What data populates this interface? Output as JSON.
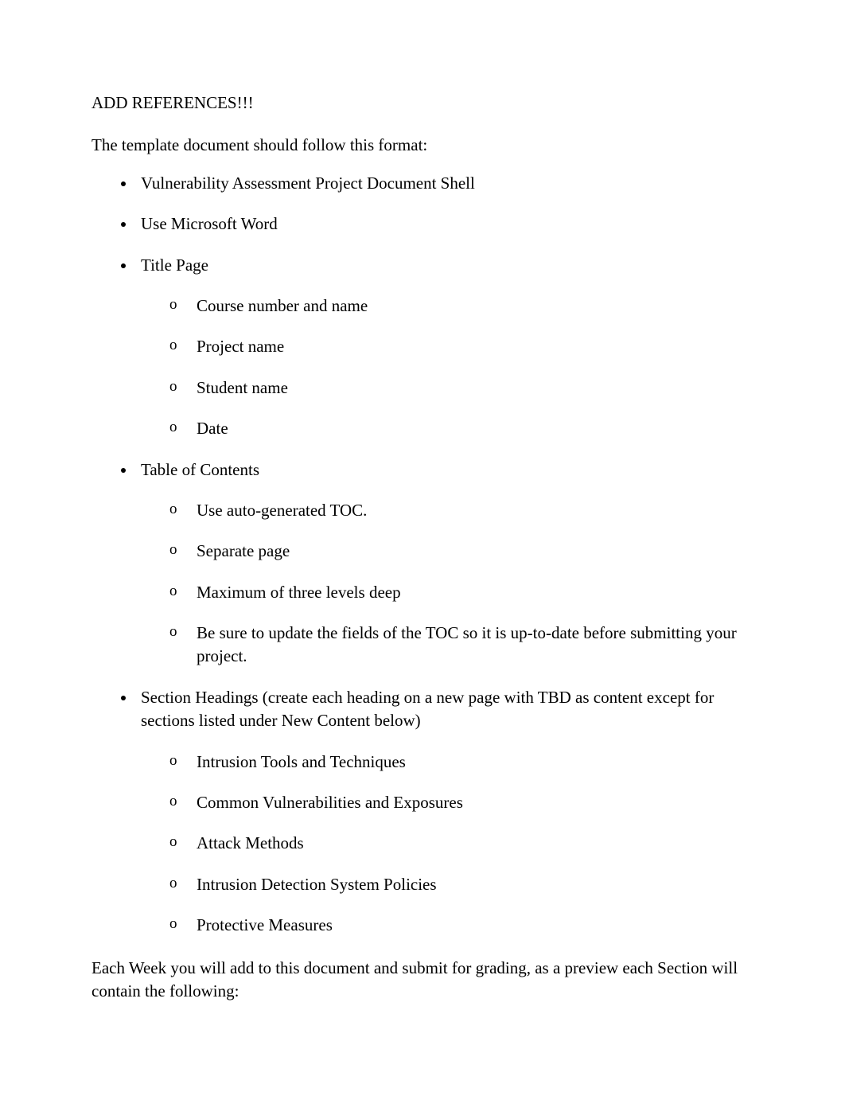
{
  "heading": "ADD REFERENCES!!!",
  "intro": "The template document should follow this format:",
  "list": [
    {
      "text": "Vulnerability Assessment Project Document Shell"
    },
    {
      "text": "Use Microsoft Word"
    },
    {
      "text": "Title Page",
      "sub": [
        "Course number and name",
        "Project name",
        "Student name",
        "Date"
      ]
    },
    {
      "text": "Table of Contents",
      "sub": [
        "Use auto-generated TOC.",
        "Separate page",
        "Maximum of three levels deep",
        "Be sure to update the fields of the TOC so it is up-to-date before submitting your project."
      ]
    },
    {
      "text": "Section Headings (create each heading on a new page with TBD as content except for sections listed under New Content below)",
      "sub": [
        "Intrusion Tools and Techniques",
        "Common Vulnerabilities and Exposures",
        "Attack Methods",
        "Intrusion Detection System Policies",
        "Protective Measures"
      ]
    }
  ],
  "closing": "Each Week you will add to this document and submit for grading, as a preview each Section will contain the following:",
  "sub_marker": "o"
}
